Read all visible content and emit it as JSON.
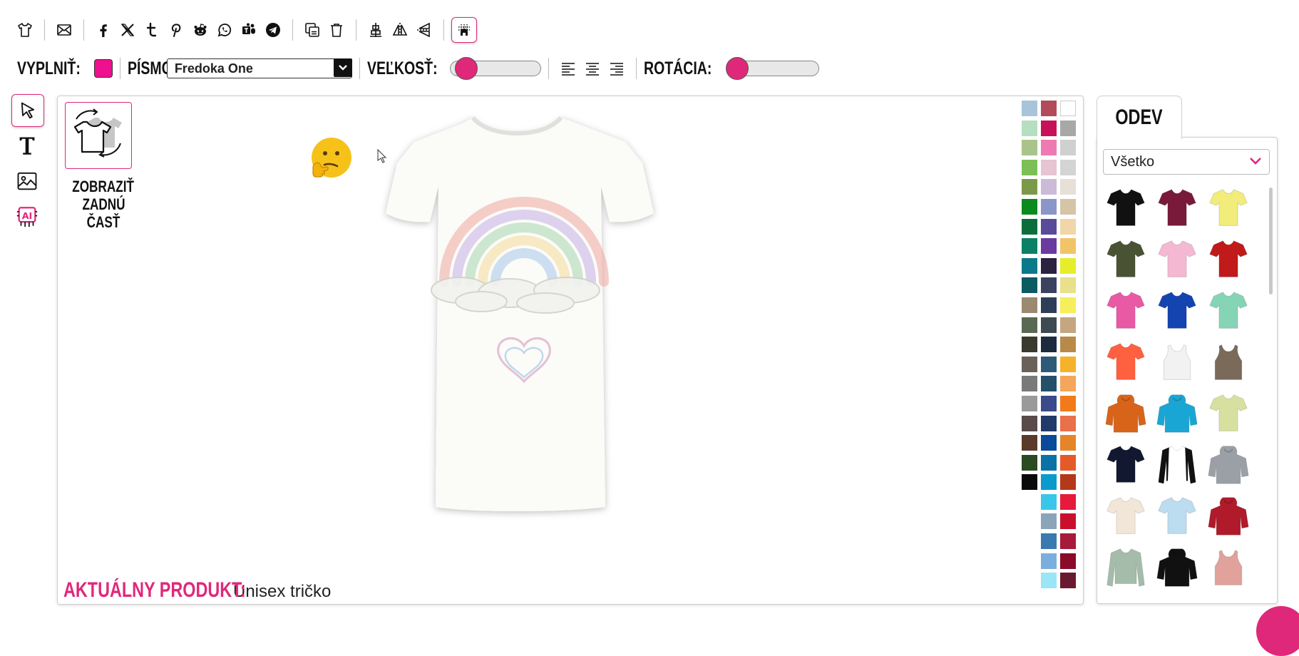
{
  "toolbar_top": {
    "icons": [
      "tshirt-icon",
      "email-icon",
      "facebook-icon",
      "x-icon",
      "tumblr-icon",
      "pinterest-icon",
      "reddit-icon",
      "whatsapp-icon",
      "teams-icon",
      "telegram-icon",
      "duplicate-icon",
      "trash-icon",
      "align-center-icon",
      "flip-horizontal-icon",
      "flip-vertical-icon",
      "grid-snap-icon"
    ]
  },
  "toolbar_second": {
    "fill_label": "VYPLNIŤ:",
    "fill_color": "#ee108e",
    "font_label": "PÍSMO:",
    "font_value": "Fredoka One",
    "size_label": "VEĽKOSŤ:",
    "size_level": 0.1,
    "rotation_label": "ROTÁCIA:",
    "rotation_level": 0.0
  },
  "left_tools": [
    "select-icon",
    "text-tool-icon",
    "image-tool-icon",
    "ai-tool-icon"
  ],
  "canvas": {
    "show_back_label_line1": "ZOBRAZIŤ",
    "show_back_label_line2": "ZADNÚ",
    "show_back_label_line3": "ČASŤ",
    "current_product_key": "AKTUÁLNY PRODUKT:",
    "current_product_value": "Unisex tričko",
    "palette_colors": [
      [
        "#a8c4da",
        "#b34a5a",
        "#ffffff"
      ],
      [
        "#b5dfc0",
        "#c8105a",
        "#a8a8a8"
      ],
      [
        "#a9c48a",
        "#ef79b3",
        "#d0d0d0"
      ],
      [
        "#7cbf56",
        "#e6c4d2",
        "#d4d4d4"
      ],
      [
        "#7a9a4a",
        "#cbbbd8",
        "#e6e0d6"
      ],
      [
        "#0c8a1e",
        "#8a96c8",
        "#d6c4a6"
      ],
      [
        "#0a6e3c",
        "#5a4a9a",
        "#f0d6a8"
      ],
      [
        "#0a8066",
        "#6a3aa0",
        "#f2c468"
      ],
      [
        "#0a7a8a",
        "#2a2240",
        "#e6ee2a"
      ],
      [
        "#0c5a62",
        "#3a4260",
        "#e8e08a"
      ],
      [
        "#9a8a72",
        "#2e3e56",
        "#f6ee5a"
      ],
      [
        "#5a6a52",
        "#3e4a52",
        "#c6a680"
      ],
      [
        "#3a3a2e",
        "#1e2a3e",
        "#b88a4a"
      ],
      [
        "#6a6258",
        "#2e5a7a",
        "#f6b22a"
      ],
      [
        "#7a7a7a",
        "#24506a",
        "#f4a65a"
      ],
      [
        "#9a9a9a",
        "#3a4a8a",
        "#f27a1a"
      ],
      [
        "#5a4a4a",
        "#203a6a",
        "#e8704a"
      ],
      [
        "#5a3a2a",
        "#0a4a9a",
        "#e6842a"
      ],
      [
        "#2a4a22",
        "#0a72a6",
        "#e65a2a"
      ],
      [
        "#0a0a0a",
        "#0a9acc",
        "#b4381a"
      ],
      [
        "",
        "#3ac6ea",
        "#e61a3a"
      ],
      [
        "",
        "#8aa4b8",
        "#c8102e"
      ],
      [
        "",
        "#3a7ab0",
        "#a61a3a"
      ],
      [
        "",
        "#7aaede",
        "#8a0a2a"
      ],
      [
        "",
        "#9ae6f6",
        "#6a1a30"
      ]
    ]
  },
  "side_panel": {
    "tab_label": "ODEV",
    "filter_value": "Všetko",
    "products": [
      {
        "name": "tshirt-black",
        "color": "#111111",
        "kind": "tee"
      },
      {
        "name": "tshirt-maroon",
        "color": "#7a1a3a",
        "kind": "tee"
      },
      {
        "name": "tshirt-yellow",
        "color": "#f2ec7a",
        "kind": "tee"
      },
      {
        "name": "tshirt-olive",
        "color": "#4a5234",
        "kind": "tee"
      },
      {
        "name": "tshirt-pink",
        "color": "#f4b8d2",
        "kind": "tee"
      },
      {
        "name": "tshirt-red",
        "color": "#c01a1a",
        "kind": "tee"
      },
      {
        "name": "tshirt-hotpink",
        "color": "#e85aa4",
        "kind": "tee"
      },
      {
        "name": "tshirt-royal",
        "color": "#1444b0",
        "kind": "tee"
      },
      {
        "name": "tshirt-mint",
        "color": "#86d4b6",
        "kind": "tee"
      },
      {
        "name": "tshirt-coral",
        "color": "#ff6040",
        "kind": "tee"
      },
      {
        "name": "tank-white",
        "color": "#f2f2f2",
        "kind": "tank"
      },
      {
        "name": "tank-brown",
        "color": "#7a6a5a",
        "kind": "tank"
      },
      {
        "name": "hoodie-orange",
        "color": "#d8641a",
        "kind": "hoodie"
      },
      {
        "name": "hoodie-cyan",
        "color": "#1aa6d4",
        "kind": "hoodie"
      },
      {
        "name": "tshirt-tiedye",
        "color": "#d8e0a0",
        "kind": "tee"
      },
      {
        "name": "tshirt-navy",
        "color": "#121830",
        "kind": "tee"
      },
      {
        "name": "raglan-black-white",
        "color": "#ffffff",
        "kind": "raglan"
      },
      {
        "name": "hoodie-grey",
        "color": "#9aa0a6",
        "kind": "hoodie"
      },
      {
        "name": "tshirt-cream",
        "color": "#f2e6d8",
        "kind": "tee"
      },
      {
        "name": "tshirt-skyfade",
        "color": "#bcdcf0",
        "kind": "tee"
      },
      {
        "name": "jacket-red",
        "color": "#b01a2a",
        "kind": "hoodie"
      },
      {
        "name": "longsleeve-sage",
        "color": "#a6bcaa",
        "kind": "longsleeve"
      },
      {
        "name": "hoodie-black-orange",
        "color": "#111111",
        "kind": "hoodie"
      },
      {
        "name": "tank-rose",
        "color": "#e0a29a",
        "kind": "tank"
      }
    ]
  }
}
